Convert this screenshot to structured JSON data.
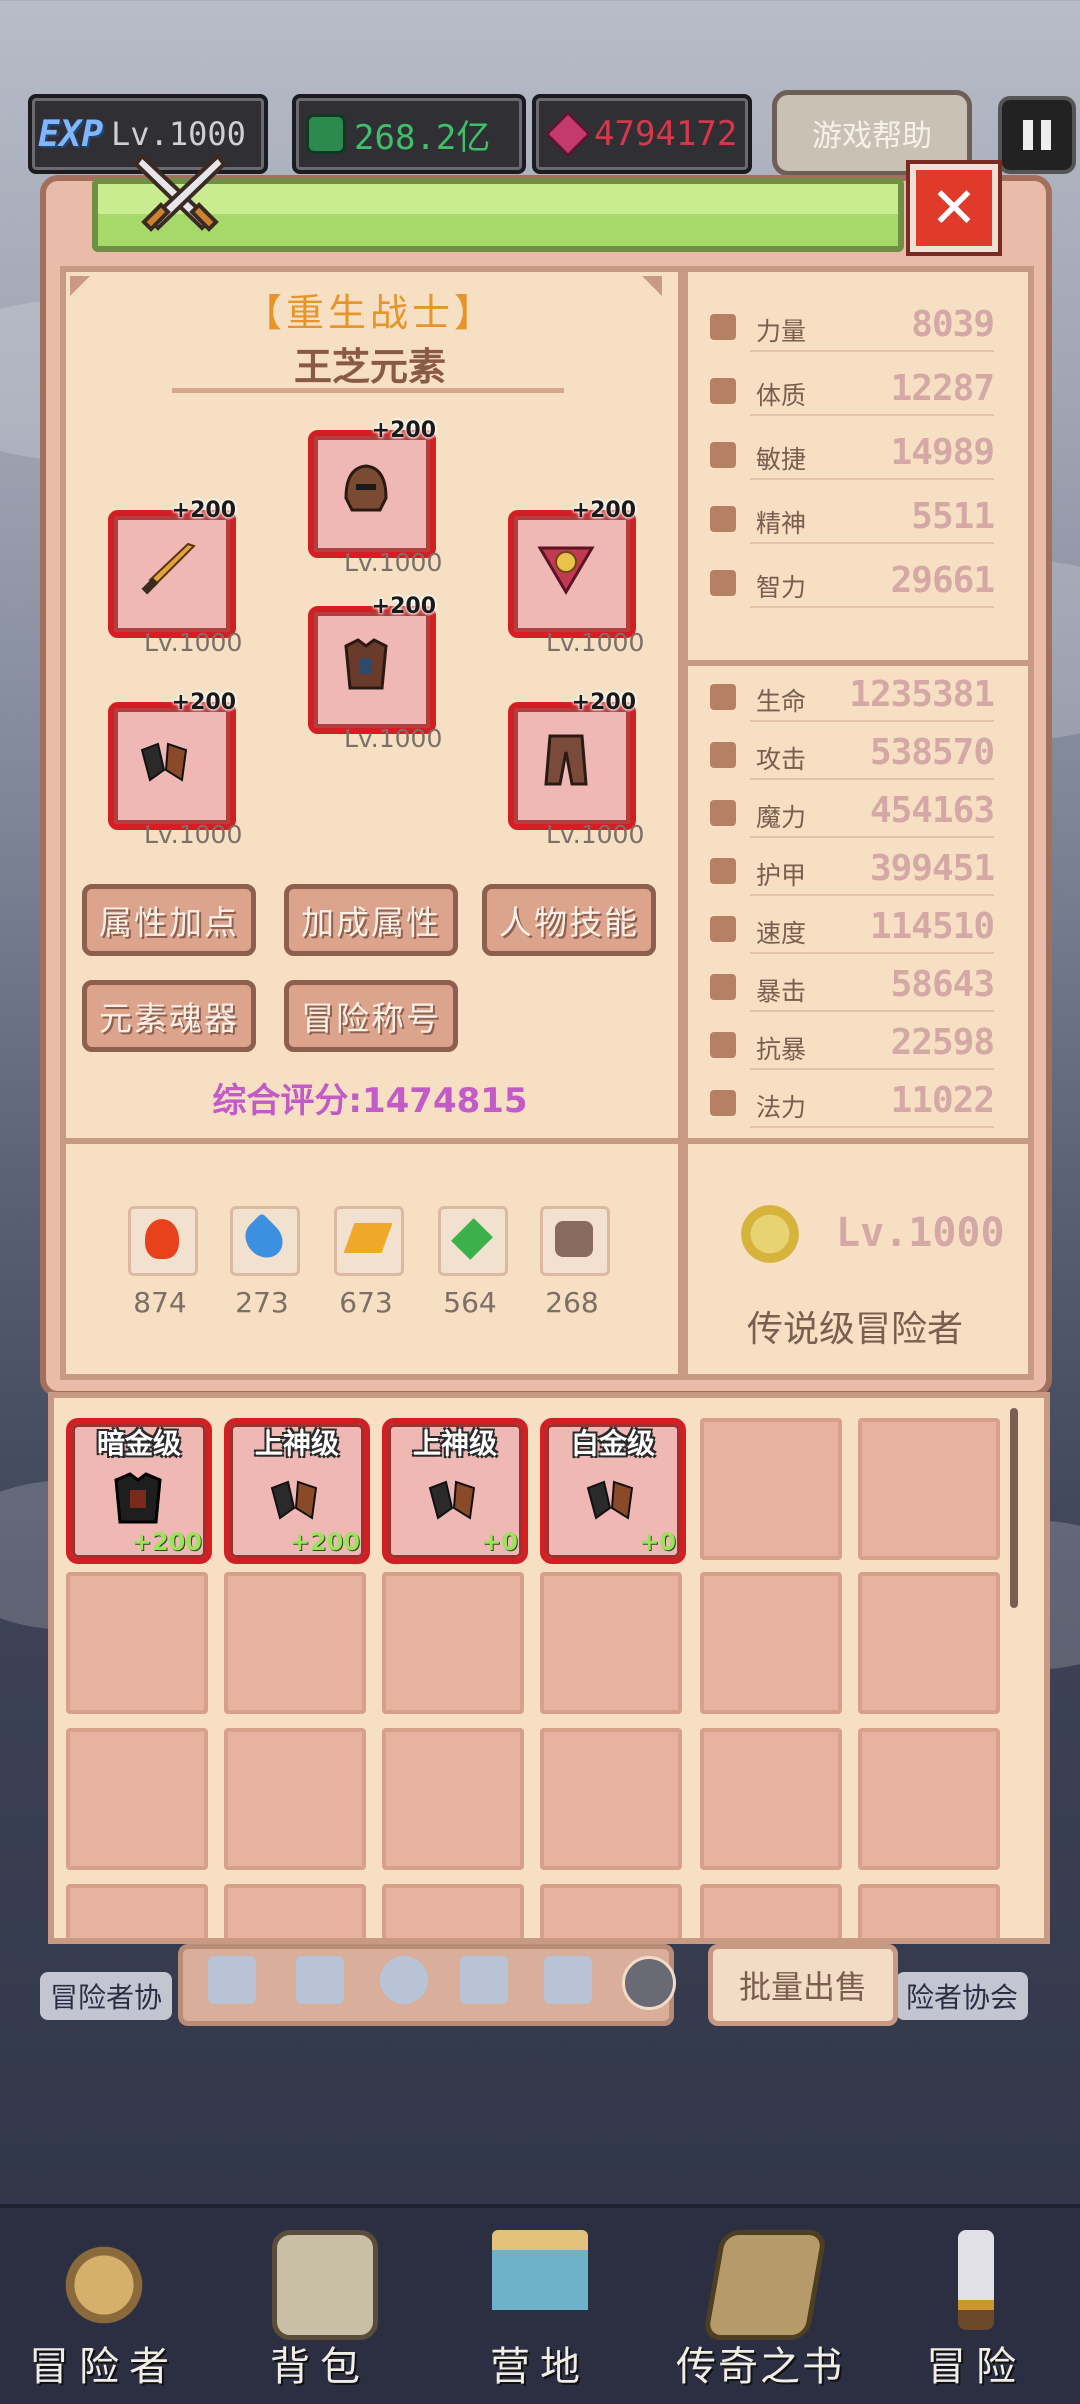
{
  "topbar": {
    "exp_label": "EXP",
    "level": "Lv.1000",
    "gems": "268.2亿",
    "rubies": "4794172",
    "help_button": "游戏帮助"
  },
  "character": {
    "class": "【重生战士】",
    "name": "王芝元素",
    "score_label": "综合评分:1474815"
  },
  "equipment": [
    {
      "slot": "head",
      "enhance": "+200",
      "level": "Lv.1000"
    },
    {
      "slot": "weapon",
      "enhance": "+200",
      "level": "Lv.1000"
    },
    {
      "slot": "amulet",
      "enhance": "+200",
      "level": "Lv.1000"
    },
    {
      "slot": "armor",
      "enhance": "+200",
      "level": "Lv.1000"
    },
    {
      "slot": "gloves",
      "enhance": "+200",
      "level": "Lv.1000"
    },
    {
      "slot": "pants",
      "enhance": "+200",
      "level": "Lv.1000"
    }
  ],
  "buttons": {
    "attr_points": "属性加点",
    "bonus_attr": "加成属性",
    "char_skills": "人物技能",
    "element_soul": "元素魂器",
    "adventure_title": "冒险称号"
  },
  "elements": [
    {
      "icon": "fire-element-icon",
      "value": "874",
      "color": "#e8421c"
    },
    {
      "icon": "water-element-icon",
      "value": "273",
      "color": "#3d8fe0"
    },
    {
      "icon": "lightning-element-icon",
      "value": "673",
      "color": "#f0a82a"
    },
    {
      "icon": "nature-element-icon",
      "value": "564",
      "color": "#3cb04a"
    },
    {
      "icon": "dark-element-icon",
      "value": "268",
      "color": "#8a6a5e"
    }
  ],
  "base_stats": [
    {
      "name": "力量",
      "value": "8039"
    },
    {
      "name": "体质",
      "value": "12287"
    },
    {
      "name": "敏捷",
      "value": "14989"
    },
    {
      "name": "精神",
      "value": "5511"
    },
    {
      "name": "智力",
      "value": "29661"
    }
  ],
  "combat_stats": [
    {
      "name": "生命",
      "value": "1235381"
    },
    {
      "name": "攻击",
      "value": "538570"
    },
    {
      "name": "魔力",
      "value": "454163"
    },
    {
      "name": "护甲",
      "value": "399451"
    },
    {
      "name": "速度",
      "value": "114510"
    },
    {
      "name": "暴击",
      "value": "58643"
    },
    {
      "name": "抗暴",
      "value": "22598"
    },
    {
      "name": "法力",
      "value": "11022"
    }
  ],
  "rank": {
    "level": "Lv.1000",
    "title": "传说级冒险者"
  },
  "inventory": [
    {
      "tier": "暗金级",
      "enhance": "+200",
      "type": "armor"
    },
    {
      "tier": "上神级",
      "enhance": "+200",
      "type": "gloves"
    },
    {
      "tier": "上神级",
      "enhance": "+0",
      "type": "gloves"
    },
    {
      "tier": "白金级",
      "enhance": "+0",
      "type": "gloves"
    }
  ],
  "filter_tabs": [
    "weapon-tab-icon",
    "shield-tab-icon",
    "helmet-tab-icon",
    "armor-tab-icon",
    "pants-tab-icon",
    "ring-tab-icon"
  ],
  "sell_button": "批量出售",
  "background_labels": {
    "left": "冒险者协",
    "right": "险者协会"
  },
  "bottom_nav": [
    {
      "label": "冒险者",
      "icon": "helmet-icon"
    },
    {
      "label": "背包",
      "icon": "backpack-icon"
    },
    {
      "label": "营地",
      "icon": "camp-banner-icon"
    },
    {
      "label": "传奇之书",
      "icon": "book-icon"
    },
    {
      "label": "冒险",
      "icon": "sword-icon"
    }
  ]
}
